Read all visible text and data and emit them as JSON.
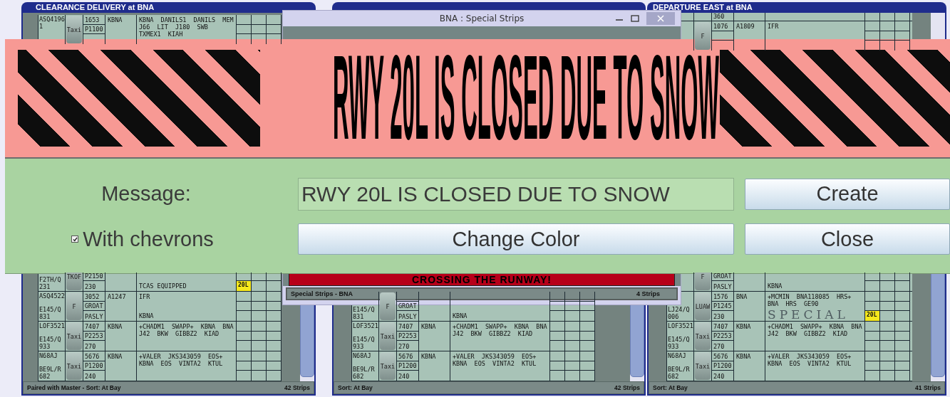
{
  "bays": [
    {
      "title": "CLEARANCE DELIVERY at BNA",
      "status_left": "Paired with Master - Sort: At Bay",
      "status_right": "42 Strips",
      "top_strips": [
        {
          "callsign": "ASQ4196",
          "note": "1",
          "button": "Taxi",
          "code": "1653",
          "fix": "P1100",
          "field": "KBNA",
          "route": "KBNA DANILS1 DANILS MEM J66 LIT J180 SWB TXMEX1 KIAH"
        }
      ],
      "bottom_strips": [
        {
          "type": "F2TH/Q",
          "number": "231",
          "button": "TKOF",
          "fix": "P2150",
          "altitude": "230",
          "remark": "TCAS EQUIPPED",
          "runway": "20L"
        },
        {
          "callsign": "ASQ4522",
          "type": "E145/Q",
          "number": "831",
          "button": "F",
          "code": "3052",
          "fix": "GROAT",
          "altitude": "PASLY",
          "field": "A1247",
          "route": "IFR",
          "remark": "KBNA"
        },
        {
          "callsign": "LOF3521",
          "type": "E145/Q",
          "number": "933",
          "button": "Taxi",
          "code": "7407",
          "fix": "P2253",
          "altitude": "270",
          "field": "KBNA",
          "route": "+CHADM1 SWAPP+ KBNA BNA J42 BKW GIBBZ2 KIAD"
        },
        {
          "callsign": "N68AJ",
          "type": "BE9L/R",
          "number": "682",
          "button": "Taxi",
          "code": "5676",
          "fix": "P1200",
          "altitude": "240",
          "field": "KBNA",
          "route": "+VALER JKS343059 EOS+ KBNA EOS VINTA2 KTUL"
        }
      ]
    },
    {
      "status_left": "Sort: At Bay",
      "status_right": "42 Strips",
      "bottom_strips": [
        {
          "type": "E145/Q",
          "number": "831",
          "button": "F",
          "fix": "GROAT",
          "altitude": "PASLY",
          "remark": "KBNA"
        },
        {
          "callsign": "LOF3521",
          "type": "E145/Q",
          "number": "933",
          "button": "Taxi",
          "code": "7407",
          "fix": "P2253",
          "altitude": "270",
          "field": "KBNA",
          "route": "+CHADM1 SWAPP+ KBNA BNA J42 BKW GIBBZ2 KIAD"
        },
        {
          "callsign": "N68AJ",
          "type": "BE9L/R",
          "number": "682",
          "button": "Taxi",
          "code": "5676",
          "fix": "P1200",
          "altitude": "240",
          "field": "KBNA",
          "route": "+VALER JKS343059 EOS+ KBNA EOS VINTA2 KTUL"
        }
      ]
    },
    {
      "title": "DEPARTURE EAST at BNA",
      "status_left": "Sort: At Bay",
      "status_right": "41 Strips",
      "top_strips": [
        {
          "partial": true,
          "altitude": "360"
        },
        {
          "button": "F",
          "code": "1076",
          "field": "A1809",
          "route": "IFR"
        }
      ],
      "bottom_strips": [
        {
          "button": "F",
          "fix": "GROAT",
          "altitude": "PASLY",
          "remark": "KBNA"
        },
        {
          "type": "LJ24/Q",
          "number": "006",
          "button": "LUAW",
          "code": "1576",
          "fix": "P1245",
          "altitude": "230",
          "field": "BNA",
          "route": "+MCMIN BNA118085 HRS+ BNA HRS GE90",
          "runway": "20L",
          "stamp": "SPECIAL"
        },
        {
          "callsign": "LOF3521",
          "type": "E145/Q",
          "number": "933",
          "button": "Taxi",
          "code": "7407",
          "fix": "P2253",
          "altitude": "270",
          "field": "KBNA",
          "route": "+CHADM1 SWAPP+ KBNA BNA J42 BKW GIBBZ2 KIAD"
        },
        {
          "callsign": "N68AJ",
          "type": "BE9L/R",
          "number": "682",
          "button": "Taxi",
          "code": "5676",
          "fix": "P1200",
          "altitude": "240",
          "field": "KBNA",
          "route": "+VALER JKS343059 EOS+ KBNA EOS VINTA2 KTUL"
        }
      ]
    }
  ],
  "special_window": {
    "title": "BNA : Special Strips",
    "strip_text": "CROSSING THE RUNWAY!",
    "status_left": "Special Strips - BNA",
    "status_right": "4 Strips"
  },
  "banner": {
    "text": "RWY 20L IS CLOSED DUE TO SNOW"
  },
  "dialog": {
    "message_label": "Message:",
    "message_value": "RWY 20L IS CLOSED DUE TO SNOW",
    "create": "Create",
    "chevrons": {
      "label": "With chevrons",
      "checked": true
    },
    "change_color": "Change Color",
    "close": "Close"
  }
}
